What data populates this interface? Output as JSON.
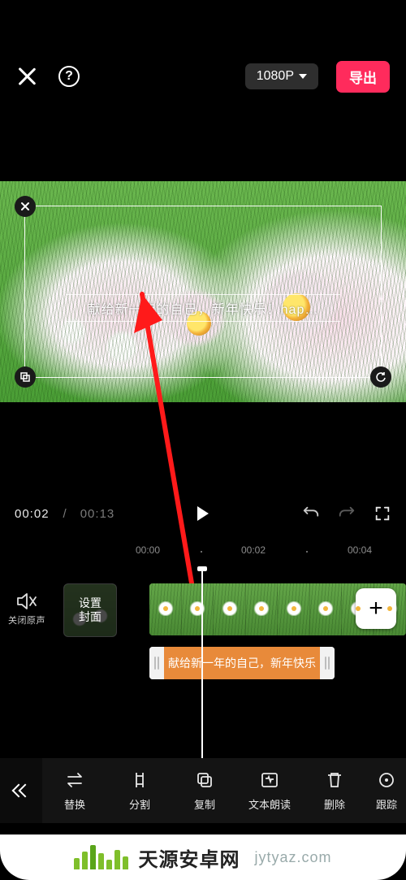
{
  "header": {
    "resolution_label": "1080P",
    "export_label": "导出"
  },
  "preview": {
    "text_overlay": "献给新一年的自己，新年快乐！hap…"
  },
  "playbar": {
    "current_time": "00:02",
    "duration": "00:13"
  },
  "ruler": {
    "t0": "00:00",
    "t1": "00:02",
    "t2": "00:04"
  },
  "timeline": {
    "mute_label": "关闭原声",
    "cover_label_line1": "设置",
    "cover_label_line2": "封面",
    "caption_text": "献给新一年的自己，新年快乐",
    "add_label": "+"
  },
  "toolbar": {
    "items": [
      {
        "id": "replace",
        "label": "替换"
      },
      {
        "id": "split",
        "label": "分割"
      },
      {
        "id": "copy",
        "label": "复制"
      },
      {
        "id": "tts",
        "label": "文本朗读"
      },
      {
        "id": "delete",
        "label": "删除"
      },
      {
        "id": "follow",
        "label": "跟踪"
      }
    ]
  },
  "footer": {
    "brand": "天源安卓网",
    "domain": "jytyaz.com"
  }
}
